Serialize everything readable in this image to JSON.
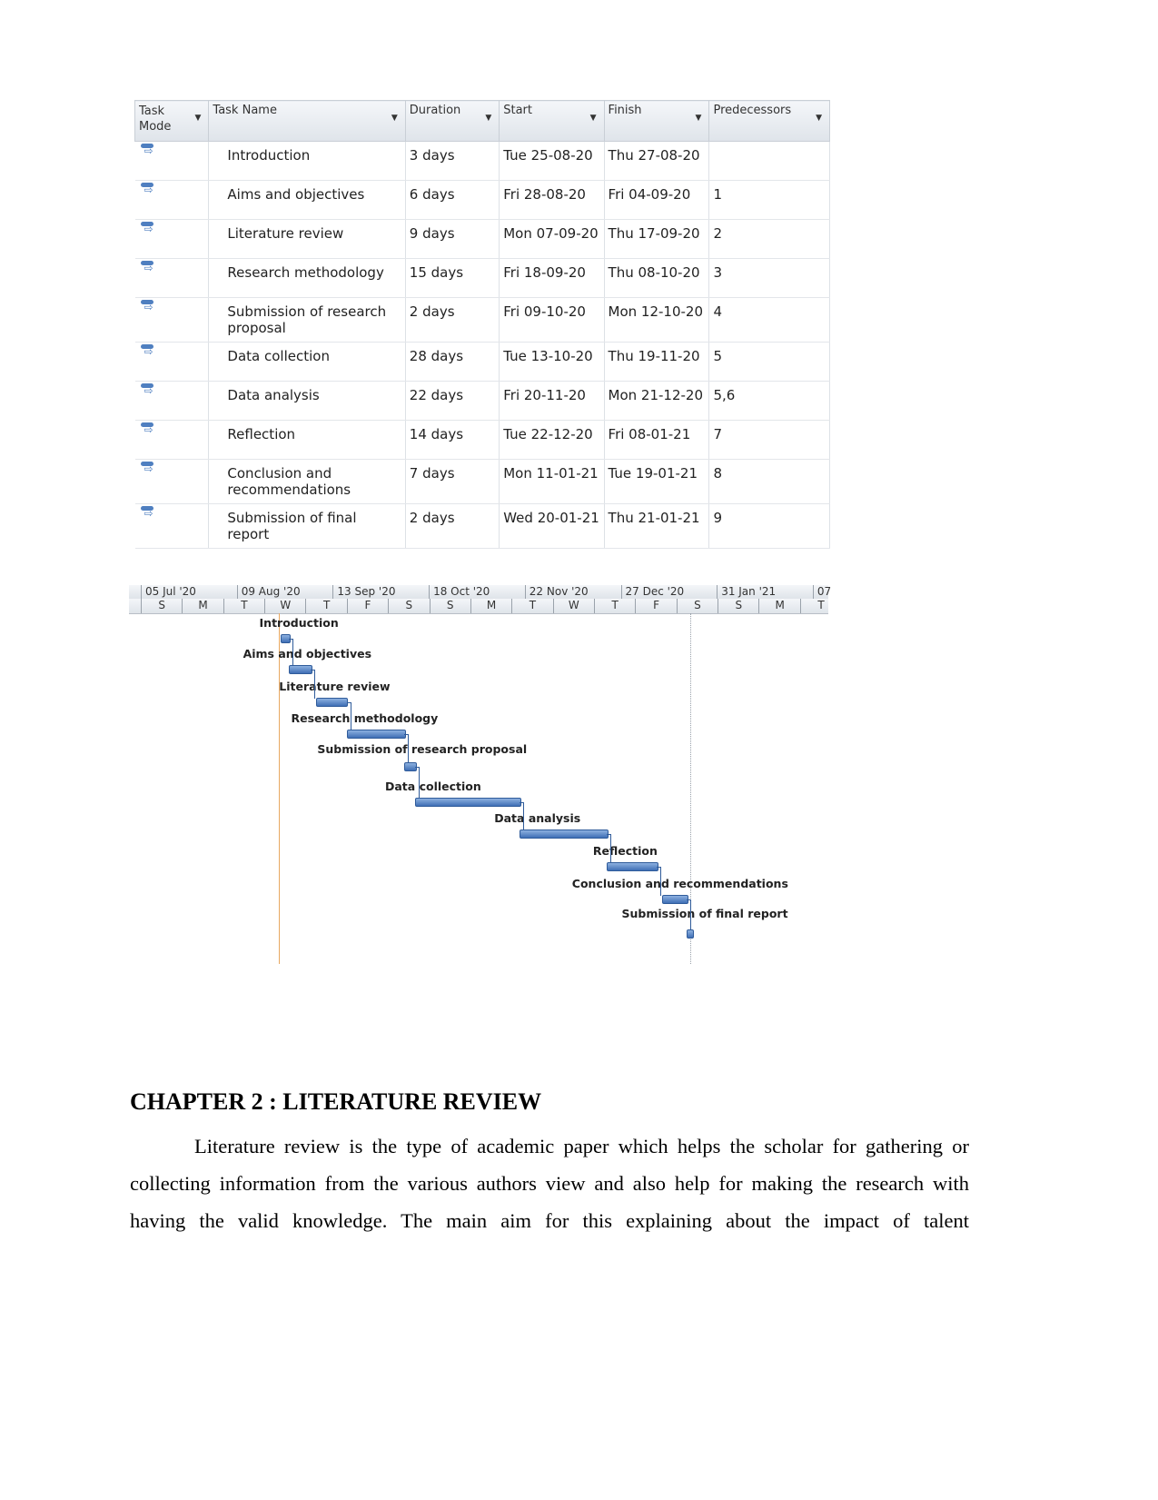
{
  "table": {
    "headers": [
      "Task Mode",
      "Task Name",
      "Duration",
      "Start",
      "Finish",
      "Predecessors"
    ],
    "rows": [
      {
        "name": "Introduction",
        "duration": "3 days",
        "start": "Tue 25-08-20",
        "finish": "Thu 27-08-20",
        "pred": ""
      },
      {
        "name": "Aims and objectives",
        "duration": "6 days",
        "start": "Fri 28-08-20",
        "finish": "Fri 04-09-20",
        "pred": "1"
      },
      {
        "name": "Literature review",
        "duration": "9 days",
        "start": "Mon 07-09-20",
        "finish": "Thu 17-09-20",
        "pred": "2"
      },
      {
        "name": "Research methodology",
        "duration": "15 days",
        "start": "Fri 18-09-20",
        "finish": "Thu 08-10-20",
        "pred": "3"
      },
      {
        "name": "Submission of research proposal",
        "duration": "2 days",
        "start": "Fri 09-10-20",
        "finish": "Mon 12-10-20",
        "pred": "4"
      },
      {
        "name": "Data collection",
        "duration": "28 days",
        "start": "Tue 13-10-20",
        "finish": "Thu 19-11-20",
        "pred": "5"
      },
      {
        "name": "Data analysis",
        "duration": "22 days",
        "start": "Fri 20-11-20",
        "finish": "Mon 21-12-20",
        "pred": "5,6"
      },
      {
        "name": "Reflection",
        "duration": "14 days",
        "start": "Tue 22-12-20",
        "finish": "Fri 08-01-21",
        "pred": "7"
      },
      {
        "name": "Conclusion and recommendations",
        "duration": "7 days",
        "start": "Mon 11-01-21",
        "finish": "Tue 19-01-21",
        "pred": "8"
      },
      {
        "name": "Submission of final report",
        "duration": "2 days",
        "start": "Wed 20-01-21",
        "finish": "Thu 21-01-21",
        "pred": "9"
      }
    ]
  },
  "gantt": {
    "periods": [
      "05 Jul '20",
      "09 Aug '20",
      "13 Sep '20",
      "18 Oct '20",
      "22 Nov '20",
      "27 Dec '20",
      "31 Jan '21",
      "07"
    ],
    "days": [
      "S",
      "M",
      "T",
      "W",
      "T",
      "F",
      "S",
      "S",
      "M",
      "T",
      "W",
      "T",
      "F",
      "S",
      "S",
      "M",
      "T"
    ],
    "bar_color": "#4f7fc0",
    "today_line_color": "#e8a860"
  },
  "document": {
    "heading": "CHAPTER 2 : LITERATURE REVIEW",
    "paragraph": "Literature review is the type of academic paper which helps the scholar for gathering or collecting information from the various authors view and also help for making the research with having the valid knowledge. The main aim for this explaining about the impact of talent"
  }
}
